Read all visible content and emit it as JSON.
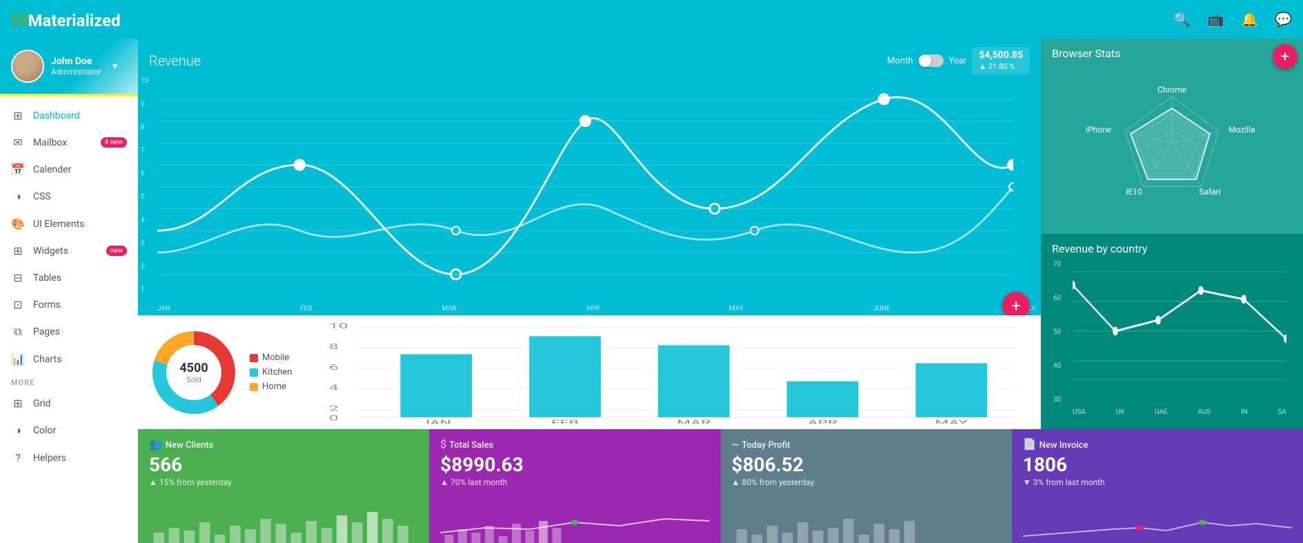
{
  "app": {
    "title": "Materialized",
    "logo_m": "M"
  },
  "topnav": {
    "icons": [
      "search",
      "monitor",
      "bell",
      "chat"
    ]
  },
  "sidebar": {
    "profile": {
      "name": "John Doe",
      "role": "Administrator"
    },
    "nav_items": [
      {
        "id": "dashboard",
        "label": "Dashboard",
        "icon": "⊞",
        "badge": null
      },
      {
        "id": "mailbox",
        "label": "Mailbox",
        "icon": "✉",
        "badge": "4 new"
      },
      {
        "id": "calender",
        "label": "Calender",
        "icon": "📅",
        "badge": null
      },
      {
        "id": "css",
        "label": "CSS",
        "icon": "◑",
        "badge": null
      },
      {
        "id": "ui-elements",
        "label": "UI Elements",
        "icon": "🎨",
        "badge": null
      },
      {
        "id": "widgets",
        "label": "Widgets",
        "icon": "⊞",
        "badge": "new"
      },
      {
        "id": "tables",
        "label": "Tables",
        "icon": "⊟",
        "badge": null
      },
      {
        "id": "forms",
        "label": "Forms",
        "icon": "⊡",
        "badge": null
      },
      {
        "id": "pages",
        "label": "Pages",
        "icon": "⧉",
        "badge": null
      },
      {
        "id": "charts",
        "label": "Charts",
        "icon": "📊",
        "badge": null
      }
    ],
    "more_label": "MORE",
    "more_items": [
      {
        "id": "grid",
        "label": "Grid",
        "icon": "⊞",
        "badge": null
      },
      {
        "id": "color",
        "label": "Color",
        "icon": "◑",
        "badge": null
      },
      {
        "id": "helpers",
        "label": "Helpers",
        "icon": "?",
        "badge": null
      }
    ]
  },
  "revenue": {
    "title": "Revenue",
    "toggle_left": "Month",
    "toggle_right": "Year",
    "value": "$4,500.85",
    "change": "▲ 21.80 %",
    "months": [
      "JAN",
      "FEB",
      "MAR",
      "APR",
      "MAY",
      "JUNE",
      "JULY"
    ],
    "y_labels": [
      "1",
      "2",
      "3",
      "4",
      "5",
      "6",
      "7",
      "8",
      "9",
      "10"
    ]
  },
  "donut": {
    "value": "4500",
    "label": "Sold",
    "legend": [
      {
        "label": "Mobile",
        "color": "#E53935"
      },
      {
        "label": "Kitchen",
        "color": "#26C6DA"
      },
      {
        "label": "Home",
        "color": "#FFA726"
      }
    ]
  },
  "bar_chart": {
    "months": [
      "JAN",
      "FEB",
      "MAR",
      "APR",
      "MAY"
    ],
    "y_labels": [
      "0",
      "2",
      "4",
      "6",
      "8",
      "10"
    ],
    "values": [
      7,
      9,
      8,
      4,
      6
    ]
  },
  "browser_stats": {
    "title": "Browser Stats",
    "labels": [
      "Chrome",
      "Mozilla",
      "Safari",
      "IE10",
      "iPhone"
    ],
    "plus_icon": "+"
  },
  "revenue_country": {
    "title": "Revenue by country",
    "x_labels": [
      "USA",
      "UK",
      "UAE",
      "AUS",
      "IN",
      "SA"
    ],
    "y_labels": [
      "30",
      "40",
      "50",
      "60",
      "70"
    ]
  },
  "stat_cards": [
    {
      "id": "new-clients",
      "icon": "👥",
      "label": "New Clients",
      "value": "566",
      "change": "▲ 15% from yesterday",
      "bg": "#4CAF50"
    },
    {
      "id": "total-sales",
      "icon": "$",
      "label": "Total Sales",
      "value": "$8990.63",
      "change": "▲ 70% last month",
      "bg": "#9C27B0"
    },
    {
      "id": "today-profit",
      "icon": "~",
      "label": "Today Profit",
      "value": "$806.52",
      "change": "▲ 80% from yesterday",
      "bg": "#607D8B"
    },
    {
      "id": "new-invoice",
      "icon": "📄",
      "label": "New Invoice",
      "value": "1806",
      "change": "▼ 3% from last month",
      "bg": "#673AB7"
    }
  ]
}
